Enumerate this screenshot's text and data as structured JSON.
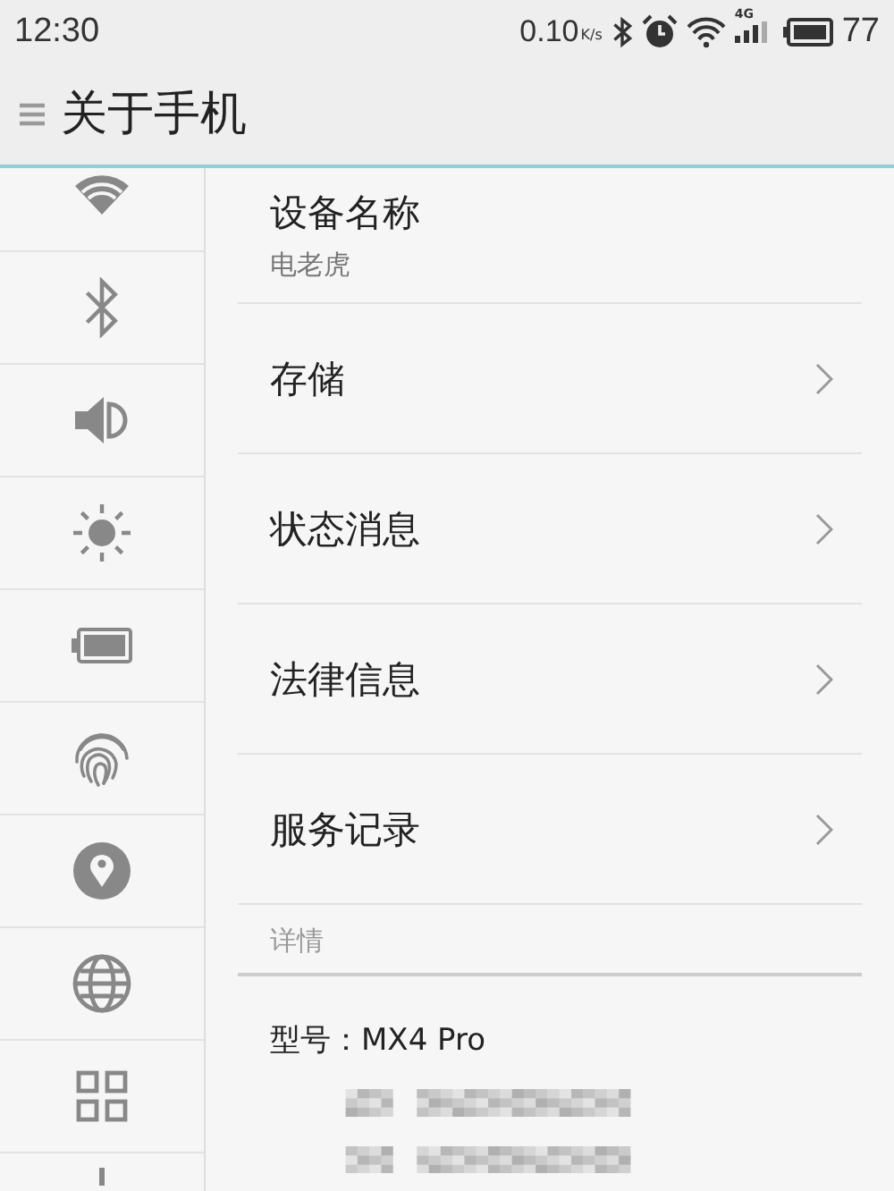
{
  "status_bar": {
    "time": "12:30",
    "net_speed": "0.10",
    "net_unit": "K/s",
    "network_type": "4G",
    "battery": "77"
  },
  "toolbar": {
    "title": "关于手机"
  },
  "sidebar": {
    "items": [
      {
        "kind": "wifi"
      },
      {
        "kind": "bluetooth"
      },
      {
        "kind": "sound"
      },
      {
        "kind": "brightness"
      },
      {
        "kind": "battery"
      },
      {
        "kind": "fingerprint"
      },
      {
        "kind": "location"
      },
      {
        "kind": "globe"
      },
      {
        "kind": "apps"
      },
      {
        "kind": "more"
      }
    ]
  },
  "settings": [
    {
      "title": "设备名称",
      "subtitle": "电老虎",
      "kind": "value"
    },
    {
      "title": "存储",
      "kind": "link"
    },
    {
      "title": "状态消息",
      "kind": "link"
    },
    {
      "title": "法律信息",
      "kind": "link"
    },
    {
      "title": "服务记录",
      "kind": "link"
    }
  ],
  "details": {
    "header": "详情",
    "model": "型号：MX4 Pro",
    "hidden_rows": [
      {
        "kind": "pixelated"
      },
      {
        "kind": "pixelated"
      }
    ]
  }
}
